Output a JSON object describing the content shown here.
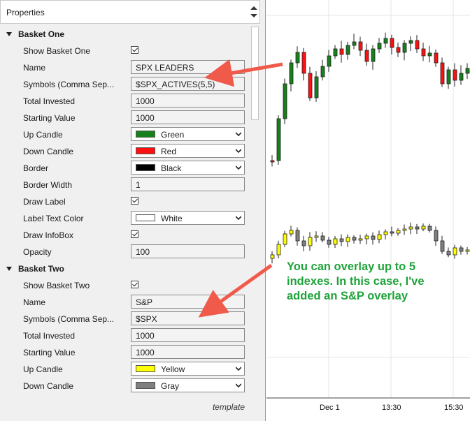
{
  "panel": {
    "title": "Properties",
    "footer_label": "template"
  },
  "basket_one": {
    "header": "Basket One",
    "rows": {
      "show": "Show Basket One",
      "name": {
        "label": "Name",
        "value": "SPX LEADERS"
      },
      "symbols": {
        "label": "Symbols (Comma Sep...",
        "value": "$SPX_ACTIVES(5,5)"
      },
      "total_invested": {
        "label": "Total Invested",
        "value": "1000"
      },
      "starting_value": {
        "label": "Starting Value",
        "value": "1000"
      },
      "up_candle": {
        "label": "Up Candle",
        "value": "Green",
        "color": "#16801c"
      },
      "down_candle": {
        "label": "Down Candle",
        "value": "Red",
        "color": "#ff1010"
      },
      "border": {
        "label": "Border",
        "value": "Black",
        "color": "#000000"
      },
      "border_width": {
        "label": "Border Width",
        "value": "1"
      },
      "draw_label": "Draw Label",
      "label_text_color": {
        "label": "Label Text Color",
        "value": "White",
        "color": "#ffffff"
      },
      "draw_infobox": "Draw InfoBox",
      "opacity": {
        "label": "Opacity",
        "value": "100"
      }
    }
  },
  "basket_two": {
    "header": "Basket Two",
    "rows": {
      "show": "Show Basket Two",
      "name": {
        "label": "Name",
        "value": "S&P"
      },
      "symbols": {
        "label": "Symbols (Comma Sep...",
        "value": "$SPX"
      },
      "total_invested": {
        "label": "Total Invested",
        "value": "1000"
      },
      "starting_value": {
        "label": "Starting Value",
        "value": "1000"
      },
      "up_candle": {
        "label": "Up Candle",
        "value": "Yellow",
        "color": "#ffff00"
      },
      "down_candle": {
        "label": "Down Candle",
        "value": "Gray",
        "color": "#808080"
      }
    }
  },
  "chart": {
    "x_ticks": [
      "Dec 1",
      "13:30",
      "15:30"
    ],
    "annotation": "You can overlay up to 5 indexes. In this case, I've added an S&P overlay",
    "colors": {
      "basket_one_up": "#16801c",
      "basket_one_down": "#ff1010",
      "basket_two_up": "#ffff00",
      "basket_two_down": "#808080",
      "arrow": "#f05a4a",
      "annotation": "#1fa33a"
    }
  }
}
